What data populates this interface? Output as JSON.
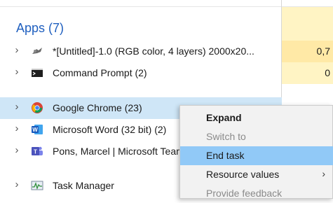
{
  "section": {
    "title": "Apps (7)"
  },
  "rows": [
    {
      "name": "*[Untitled]-1.0 (RGB color, 4 layers) 2000x20...",
      "cpu": "0,7",
      "icon": "gimp-icon"
    },
    {
      "name": "Command Prompt (2)",
      "cpu": "0",
      "icon": "command-prompt-icon"
    },
    {
      "name": "Google Chrome (23)",
      "cpu": "",
      "icon": "chrome-icon"
    },
    {
      "name": "Microsoft Word (32 bit) (2)",
      "cpu": "",
      "icon": "word-icon"
    },
    {
      "name": "Pons, Marcel | Microsoft Teams",
      "cpu": "",
      "icon": "teams-icon"
    },
    {
      "name": "Task Manager",
      "cpu": "",
      "icon": "task-manager-icon"
    }
  ],
  "context_menu": {
    "items": [
      {
        "label": "Expand",
        "bold": true,
        "disabled": false,
        "hover": false,
        "submenu": false
      },
      {
        "label": "Switch to",
        "bold": false,
        "disabled": true,
        "hover": false,
        "submenu": false
      },
      {
        "label": "End task",
        "bold": false,
        "disabled": false,
        "hover": true,
        "submenu": false
      },
      {
        "label": "Resource values",
        "bold": false,
        "disabled": false,
        "hover": false,
        "submenu": true
      },
      {
        "label": "Provide feedback",
        "bold": false,
        "disabled": true,
        "hover": false,
        "submenu": false
      }
    ]
  },
  "colors": {
    "accent": "#1f5fbf",
    "selection": "#cfe6f7",
    "menu_hover": "#91c9f7",
    "cpu_bg": "#fff4c4"
  }
}
